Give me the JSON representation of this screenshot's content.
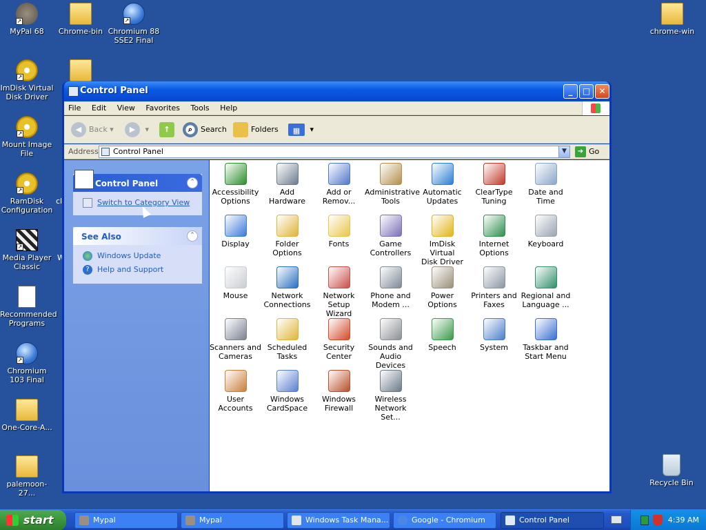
{
  "desktop": {
    "icons": [
      {
        "label": "MyPal 68"
      },
      {
        "label": "Chrome-bin"
      },
      {
        "label": "Chromium 88 SSE2 Final"
      },
      {
        "label": "chrome-win"
      },
      {
        "label": "ImDisk Virtual Disk Driver"
      },
      {
        "label": "Mount Image File"
      },
      {
        "label": "RamDisk Configuration"
      },
      {
        "label": "Media Player Classic"
      },
      {
        "label": "Recommended Programs"
      },
      {
        "label": "Chromium 103 Final"
      },
      {
        "label": "One-Core-A..."
      },
      {
        "label": "palemoon-27..."
      },
      {
        "label": "Recycle Bin"
      }
    ],
    "partial_labels": {
      "a": "cl",
      "b": "W"
    }
  },
  "window": {
    "title": "Control Panel",
    "menu": [
      "File",
      "Edit",
      "View",
      "Favorites",
      "Tools",
      "Help"
    ],
    "toolbar": {
      "back": "Back",
      "search": "Search",
      "folders": "Folders"
    },
    "address": {
      "label": "Address",
      "value": "Control Panel",
      "go": "Go"
    },
    "left_panel": {
      "control_panel": {
        "title": "Control Panel",
        "link": "Switch to Category View"
      },
      "see_also": {
        "title": "See Also",
        "links": [
          "Windows Update",
          "Help and Support"
        ]
      }
    },
    "items": [
      {
        "line1": "Accessibility",
        "line2": "Options",
        "color": "#2c8f2c"
      },
      {
        "line1": "Add Hardware",
        "line2": "",
        "color": "#6b7d8f"
      },
      {
        "line1": "Add or",
        "line2": "Remov...",
        "color": "#4f77c9"
      },
      {
        "line1": "Administrative",
        "line2": "Tools",
        "color": "#b38f4a"
      },
      {
        "line1": "Automatic",
        "line2": "Updates",
        "color": "#2c7fd1"
      },
      {
        "line1": "ClearType",
        "line2": "Tuning",
        "color": "#c23a2a"
      },
      {
        "line1": "Date and Time",
        "line2": "",
        "color": "#8aa6c9"
      },
      {
        "line1": "Display",
        "line2": "",
        "color": "#3b7ad8"
      },
      {
        "line1": "Folder Options",
        "line2": "",
        "color": "#e0b53a"
      },
      {
        "line1": "Fonts",
        "line2": "",
        "color": "#e8c64a"
      },
      {
        "line1": "Game",
        "line2": "Controllers",
        "color": "#7c6fb8"
      },
      {
        "line1": "ImDisk Virtual",
        "line2": "Disk Driver",
        "color": "#e0b51a"
      },
      {
        "line1": "Internet",
        "line2": "Options",
        "color": "#2f8f4f"
      },
      {
        "line1": "Keyboard",
        "line2": "",
        "color": "#9aa4b0"
      },
      {
        "line1": "Mouse",
        "line2": "",
        "color": "#c9ccd2"
      },
      {
        "line1": "Network",
        "line2": "Connections",
        "color": "#2a6fc0"
      },
      {
        "line1": "Network Setup",
        "line2": "Wizard",
        "color": "#c9504a"
      },
      {
        "line1": "Phone and",
        "line2": "Modem ...",
        "color": "#7d8a96"
      },
      {
        "line1": "Power Options",
        "line2": "",
        "color": "#9a8f7a"
      },
      {
        "line1": "Printers and",
        "line2": "Faxes",
        "color": "#8a96a4"
      },
      {
        "line1": "Regional and",
        "line2": "Language ...",
        "color": "#2f8f6a"
      },
      {
        "line1": "Scanners and",
        "line2": "Cameras",
        "color": "#7a8290"
      },
      {
        "line1": "Scheduled",
        "line2": "Tasks",
        "color": "#e0b53a"
      },
      {
        "line1": "Security",
        "line2": "Center",
        "color": "#d24a2a"
      },
      {
        "line1": "Sounds and",
        "line2": "Audio Devices",
        "color": "#8a8e94"
      },
      {
        "line1": "Speech",
        "line2": "",
        "color": "#3a9a4a"
      },
      {
        "line1": "System",
        "line2": "",
        "color": "#4a7fc9"
      },
      {
        "line1": "Taskbar and",
        "line2": "Start Menu",
        "color": "#3a6fd0"
      },
      {
        "line1": "User Accounts",
        "line2": "",
        "color": "#c9803a"
      },
      {
        "line1": "Windows",
        "line2": "CardSpace",
        "color": "#5a7fd0"
      },
      {
        "line1": "Windows",
        "line2": "Firewall",
        "color": "#b8502a"
      },
      {
        "line1": "Wireless",
        "line2": "Network Set...",
        "color": "#6a7a8a"
      }
    ]
  },
  "taskbar": {
    "start": "start",
    "items": [
      "Mypal",
      "Mypal",
      "Windows Task Mana...",
      "Google - Chromium",
      "Control Panel"
    ],
    "clock": "4:39 AM"
  }
}
